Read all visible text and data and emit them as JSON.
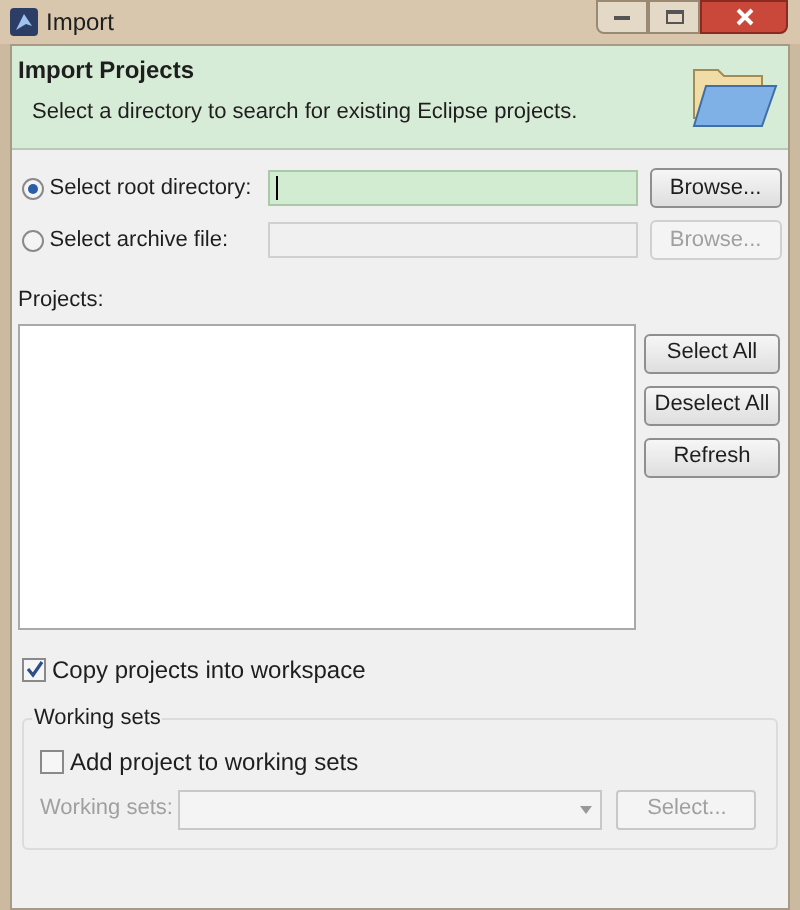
{
  "window": {
    "title": "Import"
  },
  "header": {
    "title": "Import Projects",
    "description": "Select a directory to search for existing Eclipse projects."
  },
  "sources": [
    {
      "label": "Select root directory:",
      "selected": true,
      "field_disabled": false,
      "browse": {
        "label": "Browse...",
        "disabled": false
      }
    },
    {
      "label": "Select archive file:",
      "selected": false,
      "field_disabled": true,
      "browse": {
        "label": "Browse...",
        "disabled": true
      }
    }
  ],
  "projects": {
    "label": "Projects:",
    "buttons": [
      {
        "label": "Select All"
      },
      {
        "label": "Deselect All"
      },
      {
        "label": "Refresh"
      }
    ]
  },
  "copy_option": {
    "label": "Copy projects into workspace",
    "checked": true
  },
  "working_sets": {
    "title": "Working sets",
    "add_option": {
      "label": "Add project to working sets",
      "checked": false
    },
    "label": "Working sets:",
    "disabled": true,
    "select_button": {
      "label": "Select..."
    }
  }
}
